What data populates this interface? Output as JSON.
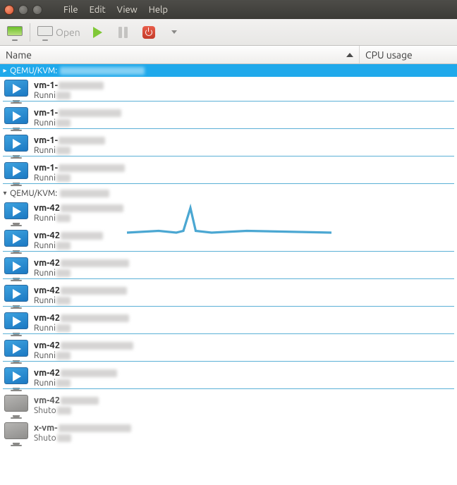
{
  "menubar": {
    "file": "File",
    "edit": "Edit",
    "view": "View",
    "help": "Help"
  },
  "toolbar": {
    "open_label": "Open"
  },
  "columns": {
    "name": "Name",
    "cpu": "CPU usage"
  },
  "groups": [
    {
      "label": "QEMU/KVM:",
      "expanded": true,
      "selected": true
    },
    {
      "label": "QEMU/KVM:",
      "expanded": true,
      "selected": false
    }
  ],
  "vms_group1": [
    {
      "name": "vm-1-",
      "state": "Runni",
      "running": true,
      "cpu": "flat"
    },
    {
      "name": "vm-1-",
      "state": "Runni",
      "running": true,
      "cpu": "flat"
    },
    {
      "name": "vm-1-",
      "state": "Runni",
      "running": true,
      "cpu": "flat"
    },
    {
      "name": "vm-1-",
      "state": "Runni",
      "running": true,
      "cpu": "flat"
    }
  ],
  "vms_group2": [
    {
      "name": "vm-42",
      "state": "Runni",
      "running": true,
      "cpu": "spike"
    },
    {
      "name": "vm-42",
      "state": "Runni",
      "running": true,
      "cpu": "flat"
    },
    {
      "name": "vm-42",
      "state": "Runni",
      "running": true,
      "cpu": "flat"
    },
    {
      "name": "vm-42",
      "state": "Runni",
      "running": true,
      "cpu": "flat"
    },
    {
      "name": "vm-42",
      "state": "Runni",
      "running": true,
      "cpu": "flat"
    },
    {
      "name": "vm-42",
      "state": "Runni",
      "running": true,
      "cpu": "flat"
    },
    {
      "name": "vm-42",
      "state": "Runni",
      "running": true,
      "cpu": "flat"
    },
    {
      "name": "vm-42",
      "state": "Shuto",
      "running": false,
      "cpu": "none"
    },
    {
      "name": "x-vm-",
      "state": "Shuto",
      "running": false,
      "cpu": "none"
    }
  ]
}
